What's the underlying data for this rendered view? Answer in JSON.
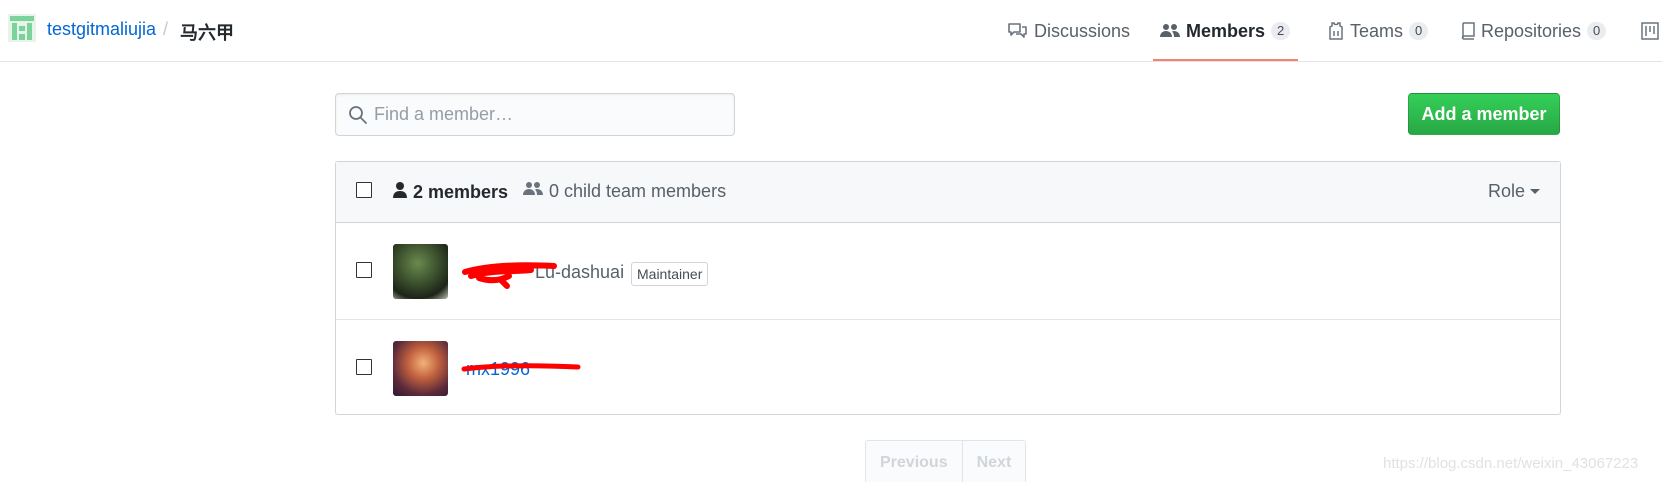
{
  "header": {
    "org_name": "testgitmaliujia",
    "separator": "/",
    "team_name": "马六甲",
    "tabs": [
      {
        "label": "Discussions",
        "icon": "comment-discussion-icon",
        "count": null
      },
      {
        "label": "Members",
        "icon": "people-icon",
        "count": "2",
        "selected": true
      },
      {
        "label": "Teams",
        "icon": "jersey-icon",
        "count": "0"
      },
      {
        "label": "Repositories",
        "icon": "repo-icon",
        "count": "0"
      },
      {
        "label": "",
        "icon": "project-icon",
        "count": null
      }
    ]
  },
  "search": {
    "placeholder": "Find a member…"
  },
  "add_member_label": "Add a member",
  "list_header": {
    "members_count_label": "2 members",
    "child_members_label": "0 child team members",
    "role_filter_label": "Role"
  },
  "members": [
    {
      "login": "",
      "full_name": "Lu-dashuai",
      "role_badge": "Maintainer"
    },
    {
      "login": "mx1996",
      "full_name": "",
      "role_badge": ""
    }
  ],
  "pagination": {
    "previous_label": "Previous",
    "next_label": "Next"
  },
  "watermark": "https://blog.csdn.net/weixin_43067223",
  "colors": {
    "link": "#0366d6",
    "accent_underline": "#f9826c",
    "primary_button": "#28a745",
    "redaction": "#ff0000"
  }
}
